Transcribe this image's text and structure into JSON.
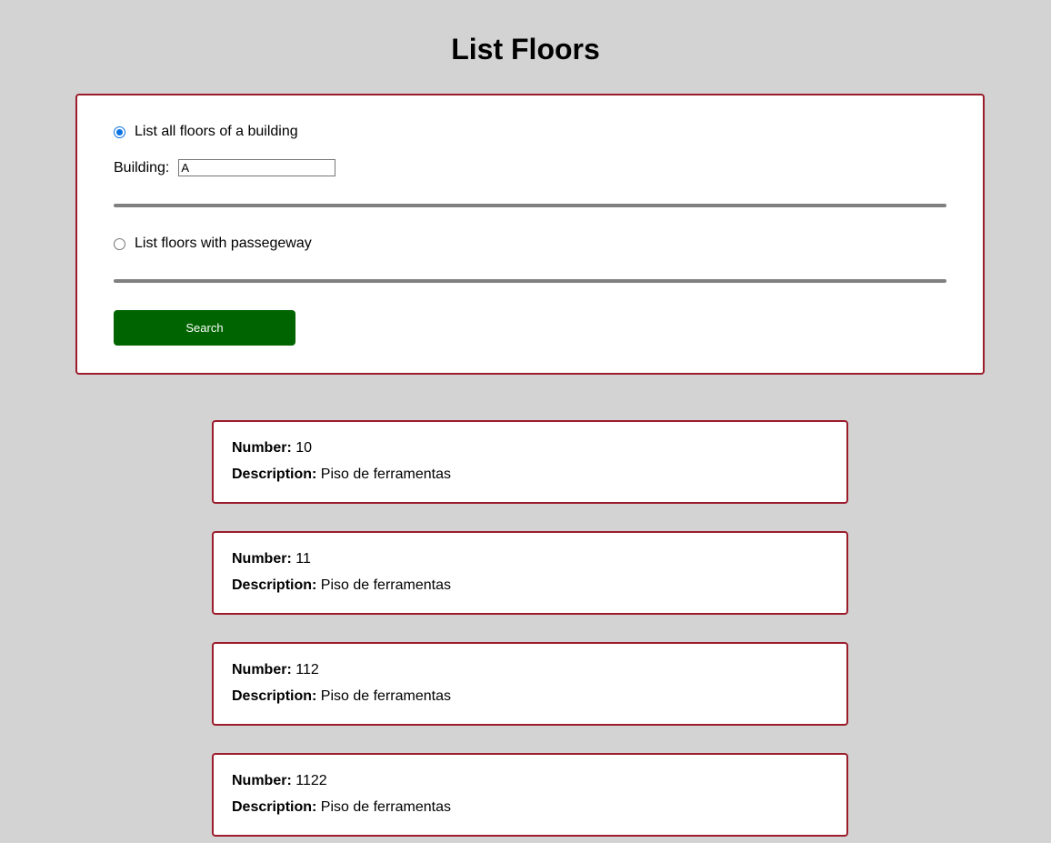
{
  "page": {
    "title": "List Floors"
  },
  "form": {
    "option_all_floors_label": "List all floors of a building",
    "option_all_floors_checked": true,
    "building_label": "Building:",
    "building_value": "A",
    "option_passageway_label": "List floors with passegeway",
    "option_passageway_checked": false,
    "search_label": "Search"
  },
  "results": {
    "number_label": "Number:",
    "description_label": "Description:",
    "floors": [
      {
        "number": "10",
        "description": "Piso de ferramentas"
      },
      {
        "number": "11",
        "description": "Piso de ferramentas"
      },
      {
        "number": "112",
        "description": "Piso de ferramentas"
      },
      {
        "number": "1122",
        "description": "Piso de ferramentas"
      }
    ]
  },
  "colors": {
    "background": "#d3d3d3",
    "panel_border": "#9b1c2b",
    "button": "#006400",
    "divider": "#808080",
    "radio_accent": "#0b73e6"
  }
}
